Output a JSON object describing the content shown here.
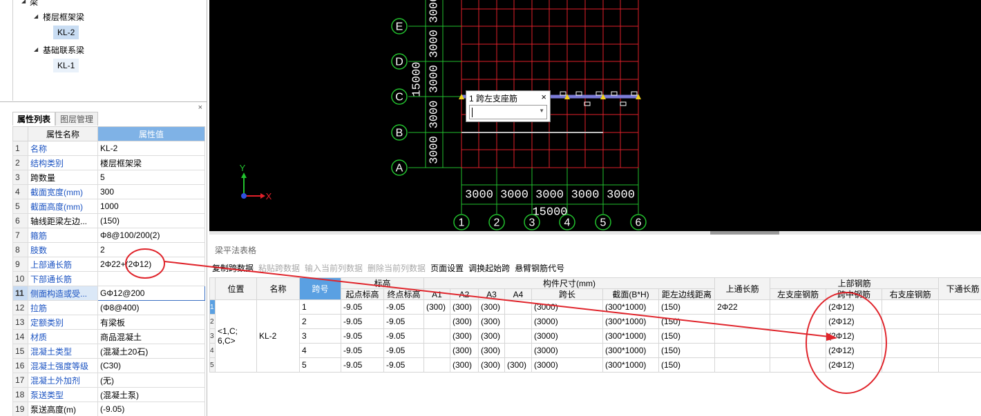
{
  "tree": {
    "root_label": "梁",
    "groups": [
      {
        "label": "楼层框架梁",
        "items": [
          "KL-2"
        ]
      },
      {
        "label": "基础联系梁",
        "items": [
          "KL-1"
        ]
      }
    ]
  },
  "props": {
    "close_glyph": "×",
    "tabs": [
      "属性列表",
      "图层管理"
    ],
    "header_name": "属性名称",
    "header_value": "属性值",
    "rows": [
      {
        "n": "1",
        "name": "名称",
        "value": "KL-2",
        "blue": true
      },
      {
        "n": "2",
        "name": "结构类别",
        "value": "楼层框架梁",
        "blue": true
      },
      {
        "n": "3",
        "name": "跨数量",
        "value": "5",
        "blue": false
      },
      {
        "n": "4",
        "name": "截面宽度(mm)",
        "value": "300",
        "blue": true
      },
      {
        "n": "5",
        "name": "截面高度(mm)",
        "value": "1000",
        "blue": true
      },
      {
        "n": "6",
        "name": "轴线距梁左边...",
        "value": "(150)",
        "blue": false
      },
      {
        "n": "7",
        "name": "箍筋",
        "value": "Φ8@100/200(2)",
        "blue": true
      },
      {
        "n": "8",
        "name": "肢数",
        "value": "2",
        "blue": true
      },
      {
        "n": "9",
        "name": "上部通长筋",
        "value": "2Φ22+(2Φ12)",
        "blue": true
      },
      {
        "n": "10",
        "name": "下部通长筋",
        "value": "",
        "blue": true
      },
      {
        "n": "11",
        "name": "侧面构造或受...",
        "value": "GΦ12@200",
        "blue": true
      },
      {
        "n": "12",
        "name": "拉筋",
        "value": "(Φ8@400)",
        "blue": true
      },
      {
        "n": "13",
        "name": "定额类别",
        "value": "有梁板",
        "blue": true
      },
      {
        "n": "14",
        "name": "材质",
        "value": "商品混凝土",
        "blue": true
      },
      {
        "n": "15",
        "name": "混凝土类型",
        "value": "(混凝土20石)",
        "blue": true
      },
      {
        "n": "16",
        "name": "混凝土强度等级",
        "value": "(C30)",
        "blue": true
      },
      {
        "n": "17",
        "name": "混凝土外加剂",
        "value": "(无)",
        "blue": true
      },
      {
        "n": "18",
        "name": "泵送类型",
        "value": "(混凝土泵)",
        "blue": true
      },
      {
        "n": "19",
        "name": "泵送高度(m)",
        "value": "(-9.05)",
        "blue": false
      }
    ]
  },
  "cad": {
    "axis_rows": [
      "E",
      "D",
      "C",
      "B",
      "A"
    ],
    "axis_cols": [
      "1",
      "2",
      "3",
      "4",
      "5",
      "6"
    ],
    "row_spacings": [
      "3000",
      "3000",
      "3000",
      "3000",
      "3000"
    ],
    "row_total": "15000",
    "col_spacings": [
      "3000",
      "3000",
      "3000",
      "3000",
      "3000"
    ],
    "col_total": "15000",
    "ucs_x": "X",
    "ucs_y": "Y",
    "colors": {
      "grid": "#e2202a",
      "axis": "#22c12e",
      "text": "#ffffff",
      "beam": "#7b7bd8"
    }
  },
  "popup": {
    "title": "1 跨左支座筋",
    "close": "×",
    "value": ""
  },
  "grid": {
    "title": "梁平法表格",
    "toolbar": [
      {
        "label": "复制跨数据",
        "enabled": true
      },
      {
        "label": "粘贴跨数据",
        "enabled": false
      },
      {
        "label": "输入当前列数据",
        "enabled": false
      },
      {
        "label": "删除当前列数据",
        "enabled": false
      },
      {
        "label": "页面设置",
        "enabled": true
      },
      {
        "label": "调换起始跨",
        "enabled": true
      },
      {
        "label": "悬臂钢筋代号",
        "enabled": true
      }
    ],
    "headers": {
      "position": "位置",
      "name": "名称",
      "span_no": "跨号",
      "elevation": "标高",
      "start_elev": "起点标高",
      "end_elev": "终点标高",
      "size_group": "构件尺寸(mm)",
      "a1": "A1",
      "a2": "A2",
      "a3": "A3",
      "a4": "A4",
      "span_len": "跨长",
      "section": "截面(B*H)",
      "left_dist": "距左边线距离",
      "top_through": "上通长筋",
      "top_rebar": "上部钢筋",
      "left_support": "左支座钢筋",
      "mid_span": "跨中钢筋",
      "right_support": "右支座钢筋",
      "bottom_through": "下通长筋"
    },
    "position_value": "<1,C;\n6,C>",
    "name_value": "KL-2",
    "rows": [
      {
        "rowno": "1",
        "span": "1",
        "start": "-9.05",
        "end": "-9.05",
        "a1": "(300)",
        "a2": "(300)",
        "a3": "(300)",
        "a4": "",
        "len": "(3000)",
        "sec": "(300*1000)",
        "dist": "(150)",
        "top": "2Φ22",
        "left": "",
        "mid": "(2Φ12)",
        "right": ""
      },
      {
        "rowno": "2",
        "span": "2",
        "start": "-9.05",
        "end": "-9.05",
        "a1": "",
        "a2": "(300)",
        "a3": "(300)",
        "a4": "",
        "len": "(3000)",
        "sec": "(300*1000)",
        "dist": "(150)",
        "top": "",
        "left": "",
        "mid": "(2Φ12)",
        "right": ""
      },
      {
        "rowno": "3",
        "span": "3",
        "start": "-9.05",
        "end": "-9.05",
        "a1": "",
        "a2": "(300)",
        "a3": "(300)",
        "a4": "",
        "len": "(3000)",
        "sec": "(300*1000)",
        "dist": "(150)",
        "top": "",
        "left": "",
        "mid": "(2Φ12)",
        "right": ""
      },
      {
        "rowno": "4",
        "span": "4",
        "start": "-9.05",
        "end": "-9.05",
        "a1": "",
        "a2": "(300)",
        "a3": "(300)",
        "a4": "",
        "len": "(3000)",
        "sec": "(300*1000)",
        "dist": "(150)",
        "top": "",
        "left": "",
        "mid": "(2Φ12)",
        "right": ""
      },
      {
        "rowno": "5",
        "span": "5",
        "start": "-9.05",
        "end": "-9.05",
        "a1": "",
        "a2": "(300)",
        "a3": "(300)",
        "a4": "(300)",
        "len": "(3000)",
        "sec": "(300*1000)",
        "dist": "(150)",
        "top": "",
        "left": "",
        "mid": "(2Φ12)",
        "right": ""
      }
    ]
  },
  "annotation": {
    "color": "#e0242b"
  }
}
